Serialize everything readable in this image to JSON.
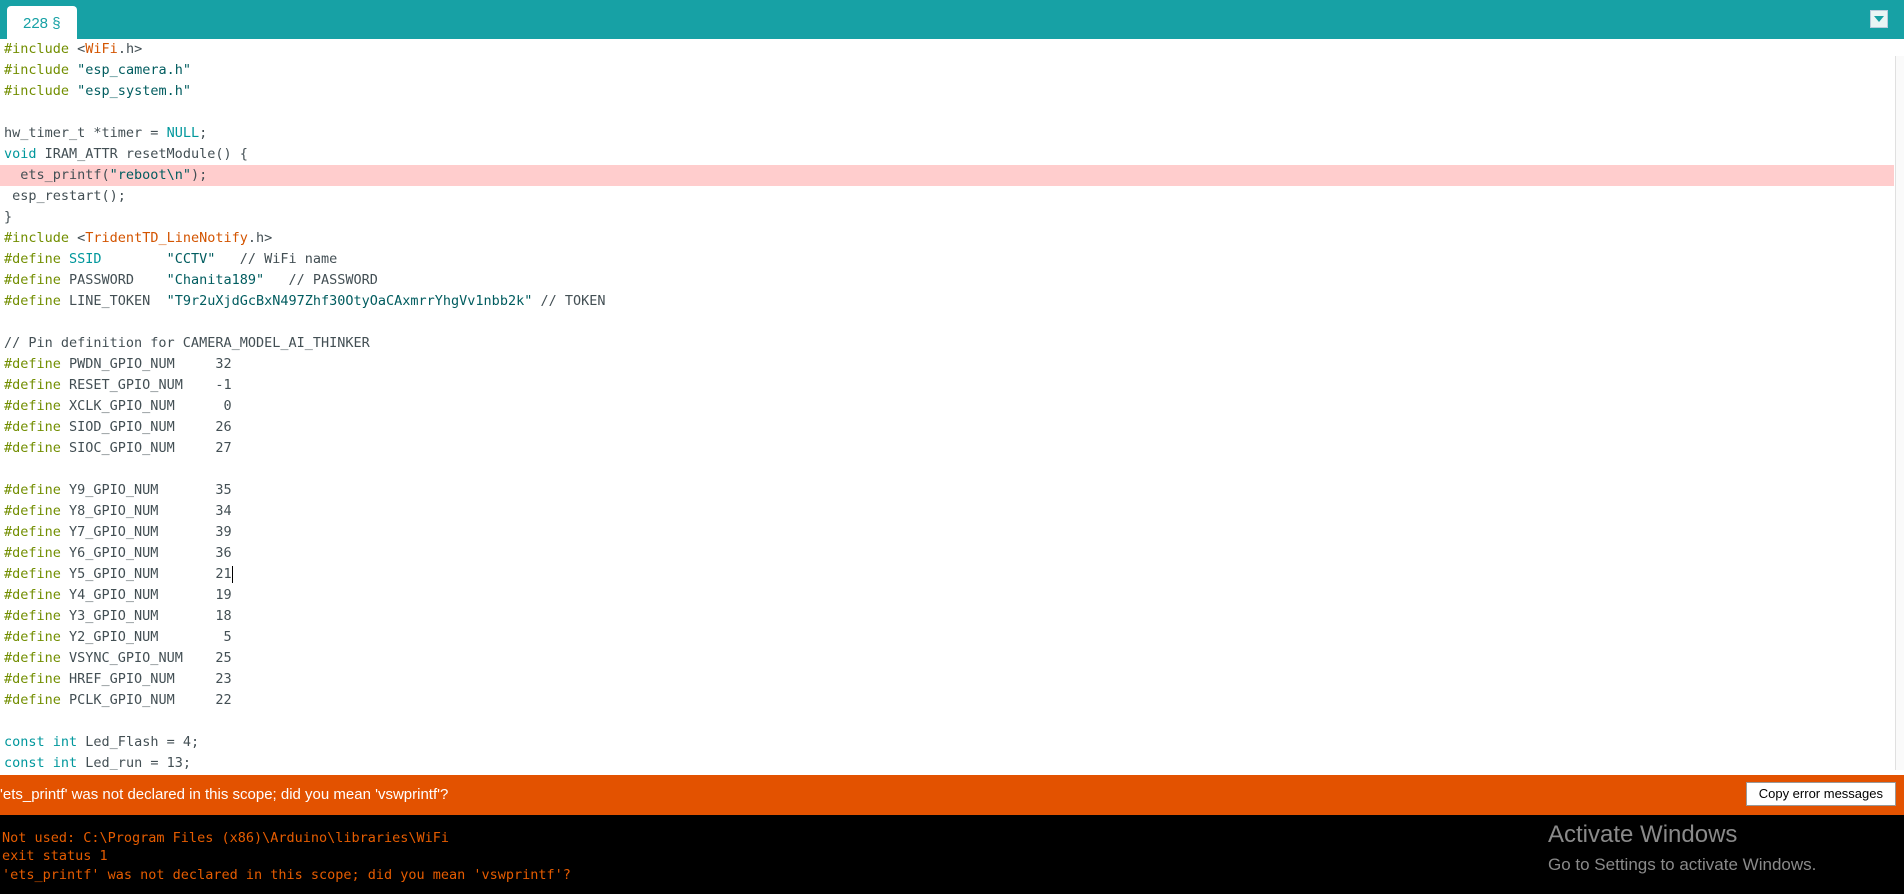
{
  "tab": {
    "label": "228 §"
  },
  "editor": {
    "lines": [
      {
        "t": "#include <WiFi.h>"
      },
      {
        "t": "#include \"esp_camera.h\""
      },
      {
        "t": "#include \"esp_system.h\""
      },
      {
        "t": ""
      },
      {
        "t": "hw_timer_t *timer = NULL;"
      },
      {
        "t": "void IRAM_ATTR resetModule() {"
      },
      {
        "t": "  ets_printf(\"reboot\\n\");"
      },
      {
        "t": " esp_restart();"
      },
      {
        "t": "}"
      },
      {
        "t": "#include <TridentTD_LineNotify.h>"
      },
      {
        "t": "#define SSID        \"CCTV\"   // WiFi name"
      },
      {
        "t": "#define PASSWORD    \"Chanita189\"   // PASSWORD"
      },
      {
        "t": "#define LINE_TOKEN  \"T9r2uXjdGcBxN497Zhf30OtyOaCAxmrrYhgVv1nbb2k\" // TOKEN"
      },
      {
        "t": ""
      },
      {
        "t": "// Pin definition for CAMERA_MODEL_AI_THINKER"
      },
      {
        "t": "#define PWDN_GPIO_NUM     32"
      },
      {
        "t": "#define RESET_GPIO_NUM    -1"
      },
      {
        "t": "#define XCLK_GPIO_NUM      0"
      },
      {
        "t": "#define SIOD_GPIO_NUM     26"
      },
      {
        "t": "#define SIOC_GPIO_NUM     27"
      },
      {
        "t": ""
      },
      {
        "t": "#define Y9_GPIO_NUM       35"
      },
      {
        "t": "#define Y8_GPIO_NUM       34"
      },
      {
        "t": "#define Y7_GPIO_NUM       39"
      },
      {
        "t": "#define Y6_GPIO_NUM       36"
      },
      {
        "t": "#define Y5_GPIO_NUM       21"
      },
      {
        "t": "#define Y4_GPIO_NUM       19"
      },
      {
        "t": "#define Y3_GPIO_NUM       18"
      },
      {
        "t": "#define Y2_GPIO_NUM        5"
      },
      {
        "t": "#define VSYNC_GPIO_NUM    25"
      },
      {
        "t": "#define HREF_GPIO_NUM     23"
      },
      {
        "t": "#define PCLK_GPIO_NUM     22"
      },
      {
        "t": ""
      },
      {
        "t": "const int Led_Flash = 4;"
      },
      {
        "t": "const int Led_run = 13;"
      }
    ],
    "error_line": 6,
    "cursor_line": 25
  },
  "error_banner": {
    "message": "'ets_printf' was not declared in this scope; did you mean 'vswprintf'?",
    "copy_button": "Copy error messages"
  },
  "console": {
    "lines": [
      "Not used: C:\\Program Files (x86)\\Arduino\\libraries\\WiFi",
      "exit status 1",
      "'ets_printf' was not declared in this scope; did you mean 'vswprintf'?"
    ]
  },
  "watermark": {
    "title": "Activate Windows",
    "subtitle": "Go to Settings to activate Windows."
  },
  "colors": {
    "tabbar": "#17a1a5",
    "error_banner": "#e35200",
    "error_line": "#ffcdcd",
    "keyword": "#728e00",
    "type": "#00979c",
    "string": "#005c5f",
    "library": "#d35400",
    "console_text": "#e65c00"
  }
}
